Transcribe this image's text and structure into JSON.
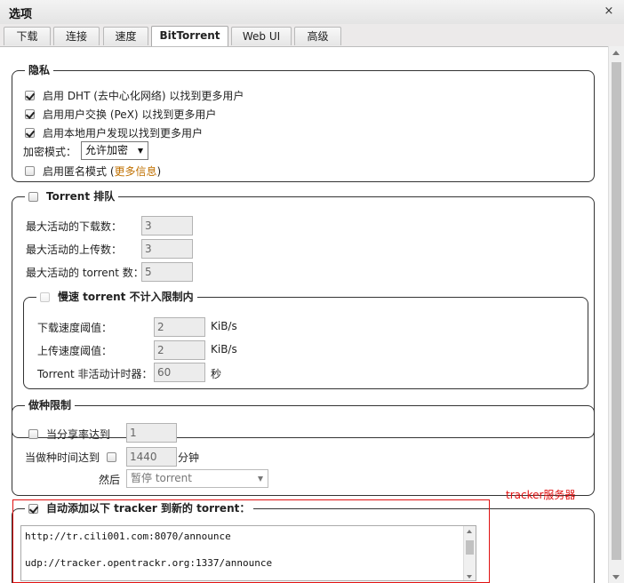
{
  "window": {
    "title": "选项",
    "close_glyph": "×"
  },
  "tabs": [
    {
      "label": "下载",
      "active": false
    },
    {
      "label": "连接",
      "active": false
    },
    {
      "label": "速度",
      "active": false
    },
    {
      "label": "BitTorrent",
      "active": true
    },
    {
      "label": "Web UI",
      "active": false
    },
    {
      "label": "高级",
      "active": false
    }
  ],
  "privacy": {
    "legend": "隐私",
    "dht": {
      "label": "启用 DHT (去中心化网络) 以找到更多用户",
      "checked": true
    },
    "pex": {
      "label": "启用用户交换 (PeX) 以找到更多用户",
      "checked": true
    },
    "lsd": {
      "label": "启用本地用户发现以找到更多用户",
      "checked": true
    },
    "encryption_label": "加密模式：",
    "encryption_value": "允许加密",
    "anonymous": {
      "label_prefix": "启用匿名模式 (",
      "link": "更多信息",
      "label_suffix": ")",
      "checked": false
    }
  },
  "queueing": {
    "legend": "Torrent 排队",
    "enabled": false,
    "max_downloads_label": "最大活动的下载数：",
    "max_downloads": "3",
    "max_uploads_label": "最大活动的上传数：",
    "max_uploads": "3",
    "max_torrents_label": "最大活动的 torrent 数：",
    "max_torrents": "5",
    "slow": {
      "legend": "慢速 torrent 不计入限制内",
      "enabled": false,
      "dl_threshold_label": "下载速度阈值：",
      "dl_threshold": "2",
      "dl_unit": "KiB/s",
      "ul_threshold_label": "上传速度阈值：",
      "ul_threshold": "2",
      "ul_unit": "KiB/s",
      "inactive_timer_label": "Torrent 非活动计时器：",
      "inactive_timer": "60",
      "inactive_unit": "秒"
    }
  },
  "seeding": {
    "legend": "做种限制",
    "ratio_label": "当分享率达到",
    "ratio_enabled": false,
    "ratio_value": "1",
    "time_label": "当做种时间达到",
    "time_enabled": false,
    "time_value": "1440",
    "time_unit": "分钟",
    "then_label": "然后",
    "then_action": "暂停 torrent"
  },
  "trackers": {
    "legend": "自动添加以下 tracker 到新的 torrent：",
    "enabled": true,
    "list": [
      "http://tr.cili001.com:8070/announce",
      "udp://tracker.opentrackr.org:1337/announce"
    ]
  },
  "annotation": {
    "text": "tracker服务器",
    "color": "#e01010"
  }
}
